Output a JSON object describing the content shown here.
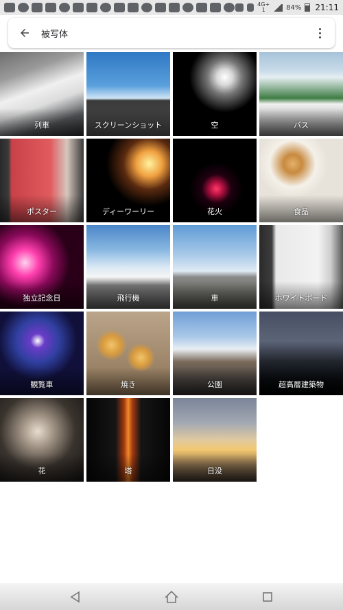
{
  "status_bar": {
    "network": "4G+",
    "network_sub": "1",
    "battery": "84%",
    "time": "21:11",
    "left_icons": [
      "cast-icon",
      "facebook-icon",
      "line-icon",
      "line-icon",
      "line-icon",
      "chat-icon",
      "chat-icon",
      "chat-icon",
      "chat-icon",
      "home-icon",
      "camera-icon",
      "sync-icon",
      "tv-icon",
      "crown-icon",
      "photo-icon",
      "warning-icon",
      "line-icon"
    ],
    "right_icons": [
      "nfc-icon",
      "vibrate-icon",
      "signal-icon",
      "battery-icon"
    ]
  },
  "search": {
    "query": "被写体"
  },
  "albums": [
    {
      "label": "列車",
      "bg": "linear-gradient(160deg,#6e6e6e 0%,#9a9a9a 25%,#f0f0f0 45%,#dcdcdc 60%,#55585c 80%,#2a2a2a 100%)"
    },
    {
      "label": "スクリーンショット",
      "bg": "linear-gradient(#2f78c4 0%,#5aa0dc 40%,#cfe4f5 55%,#3a3a3a 58%,#505050 100%)"
    },
    {
      "label": "空",
      "bg": "radial-gradient(circle at 62% 30%,#ffffff 0%,#d9d9d9 10%,#777 22%,#000 45%),radial-gradient(circle at 35% 65%,#e8d8b0 0%,#5a4a30 15%,#000 35%)"
    },
    {
      "label": "バス",
      "bg": "linear-gradient(#a7c3d9 0%,#c8dbe9 22%,#e6eef2 30%,#3f7d44 55%,#f1f1f1 62%,#aaa 85%,#777 100%)"
    },
    {
      "label": "ポスター",
      "bg": "linear-gradient(90deg,#2a2a2a 0%,#3a3a3a 10%,#c94148 14%,#e05b5e 60%,#d6c7bd 80%,#3a3a3a 100%)"
    },
    {
      "label": "ディーワーリー",
      "bg": "radial-gradient(circle at 75% 30%,#fff3a0 0%,#f0a040 15%,#5a2a10 30%,#000 50%),radial-gradient(circle at 20% 70%,#ff6ad5 0%,#7a1a6a 18%,#000 35%)"
    },
    {
      "label": "花火",
      "bg": "radial-gradient(circle at 52% 60%,#ff3a6a 0%,#b01040 10%,#200010 22%,#000 40%),linear-gradient(#05030a,#000)"
    },
    {
      "label": "食品",
      "bg": "radial-gradient(circle at 40% 30%,#e3b06a 0%,#c88a40 12%,#f4f1ea 30%,#e8e3da 45%),radial-gradient(circle at 25% 75%,#c7a575 0%,#7a5a3a 20%,#3b3b3b 40%)"
    },
    {
      "label": "独立記念日",
      "bg": "radial-gradient(circle at 30% 45%,#ffd2f0 0%,#ff3fae 18%,#8a0a5a 38%,#2a0018 60%),radial-gradient(circle at 70% 30%,#ffffff 0%,#ff66cc 20%,#000 45%)"
    },
    {
      "label": "飛行機",
      "bg": "linear-gradient(#4a86c8 0%,#8ab8e2 30%,#d9e8f4 50%,#f5f5f5 62%,#7a7a7a 72%,#555 100%)"
    },
    {
      "label": "車",
      "bg": "linear-gradient(#5f9bd6 0%,#a7c9e8 35%,#dfeaf4 55%,#8a8a8a 62%,#6d6d66 80%,#4a4a44 100%)"
    },
    {
      "label": "ホワイトボード",
      "bg": "linear-gradient(90deg,#2a2a2a 0%,#3d3d3d 15%,#e9e9e9 20%,#f3f3f3 70%,#cfcfcf 85%,#5a5a5a 100%)"
    },
    {
      "label": "観覧車",
      "bg": "radial-gradient(circle at 45% 35%,#ffffff 0%,#6a3cc8 10%,#3040a0 30%,#10103a 55%),linear-gradient(#0a0a2a,#000)"
    },
    {
      "label": "焼き",
      "bg": "radial-gradient(circle at 30% 40%,#f2c46a 0%,#d89a3e 12%,transparent 20%),radial-gradient(circle at 65% 55%,#f2c46a 0%,#d89a3e 12%,transparent 20%),linear-gradient(#bba58a,#8a7255)"
    },
    {
      "label": "公園",
      "bg": "linear-gradient(#6f9fd6 0%,#a9c8e8 30%,#e9eef3 45%,#7a6a5a 60%,#4a4440 80%,#2d2b29 100%)"
    },
    {
      "label": "超高層建築物",
      "bg": "linear-gradient(#474e63 0%,#5c6478 35%,#20242c 60%,#0a0c10 80%,#000 100%),radial-gradient(circle at 50% 70%,#2adfc8 0%,transparent 30%)"
    },
    {
      "label": "花",
      "bg": "radial-gradient(circle at 45% 40%,#e7dccd 0%,#9b8e80 25%,#3a342e 55%,#141210 100%)"
    },
    {
      "label": "塔",
      "bg": "linear-gradient(90deg,#050505 0%,#151515 35%,#a23a10 45%,#f28a2a 50%,#a23a10 55%,#151515 65%,#050505 100%)"
    },
    {
      "label": "日没",
      "bg": "linear-gradient(#7a8498 0%,#a3a9b3 30%,#e0c9a0 50%,#f3c770 62%,#8c7250 80%,#3a3028 100%)"
    }
  ],
  "nav": {
    "icons": [
      "back-triangle-icon",
      "home-outline-icon",
      "recents-square-icon"
    ]
  }
}
